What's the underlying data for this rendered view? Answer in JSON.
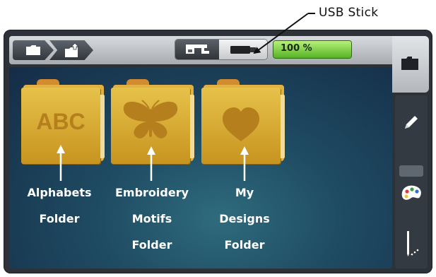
{
  "annotations": {
    "usb_label": "USB Stick"
  },
  "toolbar": {
    "breadcrumb": [
      {
        "icon": "folder-icon"
      },
      {
        "icon": "folder-up-icon"
      }
    ],
    "storage": {
      "machine_icon": "embroidery-machine-icon",
      "usb_icon": "usb-stick-icon",
      "selected": "usb"
    },
    "capacity_text": "100 %"
  },
  "side_tabs": [
    {
      "icon": "folder-icon",
      "active": true
    },
    {
      "icon": "pencil-icon",
      "active": false
    },
    {
      "icon": "palette-icon",
      "active": false
    },
    {
      "icon": "needle-stitch-icon",
      "active": false
    }
  ],
  "folders": [
    {
      "icon_text": "ABC",
      "caption": [
        "Alphabets",
        "Folder"
      ]
    },
    {
      "icon": "butterfly-icon",
      "caption": [
        "Embroidery",
        "Motifs",
        "Folder"
      ]
    },
    {
      "icon": "heart-icon",
      "caption": [
        "My",
        "Designs",
        "Folder"
      ]
    }
  ],
  "colors": {
    "capacity_bar": "#7ccf3d",
    "folder": "#dcae3a",
    "content_bg": "#1d4560"
  }
}
